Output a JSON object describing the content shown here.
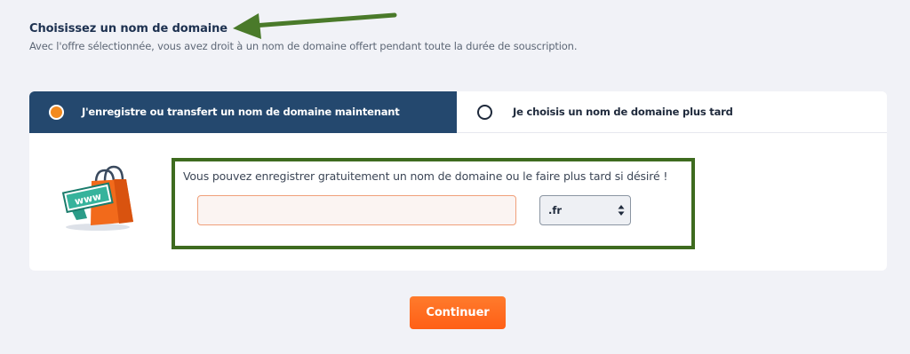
{
  "header": {
    "title": "Choisissez un nom de domaine",
    "subtitle": "Avec l'offre sélectionnée, vous avez droit à un nom de domaine offert pendant toute la durée de souscription."
  },
  "tabs": [
    {
      "label": "J'enregistre ou transfert un nom de domaine maintenant",
      "selected": true
    },
    {
      "label": "Je choisis un nom de domaine plus tard",
      "selected": false
    }
  ],
  "domain_form": {
    "info": "Vous pouvez enregistrer gratuitement un nom de domaine ou le faire plus tard si désiré !",
    "input_value": "",
    "tld_value": ".fr"
  },
  "shop_icon_label": "www",
  "continue_label": "Continuer",
  "colors": {
    "page_bg": "#f1f2f7",
    "tab_active": "#24486e",
    "accent_orange": "#ff6a1f",
    "annotation_green": "#4a7a2a"
  }
}
